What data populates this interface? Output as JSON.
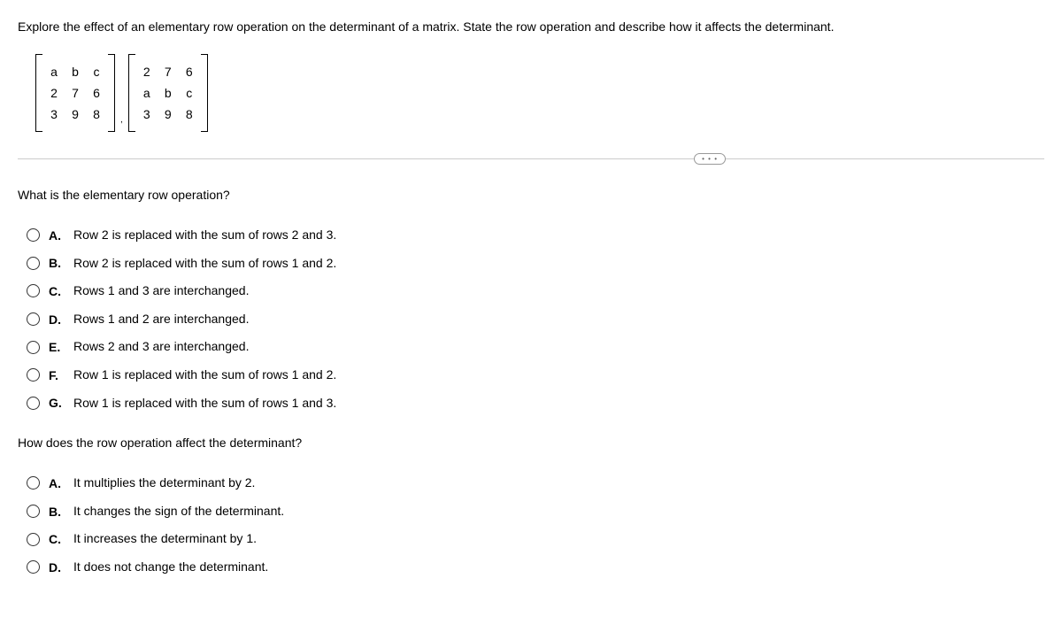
{
  "intro": "Explore the effect of an elementary row operation on the determinant of a matrix. State the row operation and describe how it affects the determinant.",
  "matrix1": {
    "r1": [
      "a",
      "b",
      "c"
    ],
    "r2": [
      "2",
      "7",
      "6"
    ],
    "r3": [
      "3",
      "9",
      "8"
    ]
  },
  "matrix2": {
    "r1": [
      "2",
      "7",
      "6"
    ],
    "r2": [
      "a",
      "b",
      "c"
    ],
    "r3": [
      "3",
      "9",
      "8"
    ]
  },
  "separator": ",",
  "dots": "• • •",
  "q1": {
    "prompt": "What is the elementary row operation?",
    "options": [
      {
        "letter": "A.",
        "text": "Row 2 is replaced with the sum of rows 2 and 3."
      },
      {
        "letter": "B.",
        "text": "Row 2 is replaced with the sum of rows 1 and 2."
      },
      {
        "letter": "C.",
        "text": "Rows 1 and 3 are interchanged."
      },
      {
        "letter": "D.",
        "text": "Rows 1 and 2 are interchanged."
      },
      {
        "letter": "E.",
        "text": "Rows 2 and 3 are interchanged."
      },
      {
        "letter": "F.",
        "text": "Row 1 is replaced with the sum of rows 1 and 2."
      },
      {
        "letter": "G.",
        "text": "Row 1 is replaced with the sum of rows 1 and 3."
      }
    ]
  },
  "q2": {
    "prompt": "How does the row operation affect the determinant?",
    "options": [
      {
        "letter": "A.",
        "text": "It multiplies the determinant by 2."
      },
      {
        "letter": "B.",
        "text": "It changes the sign of the determinant."
      },
      {
        "letter": "C.",
        "text": "It increases the determinant by 1."
      },
      {
        "letter": "D.",
        "text": "It does not change the determinant."
      }
    ]
  }
}
